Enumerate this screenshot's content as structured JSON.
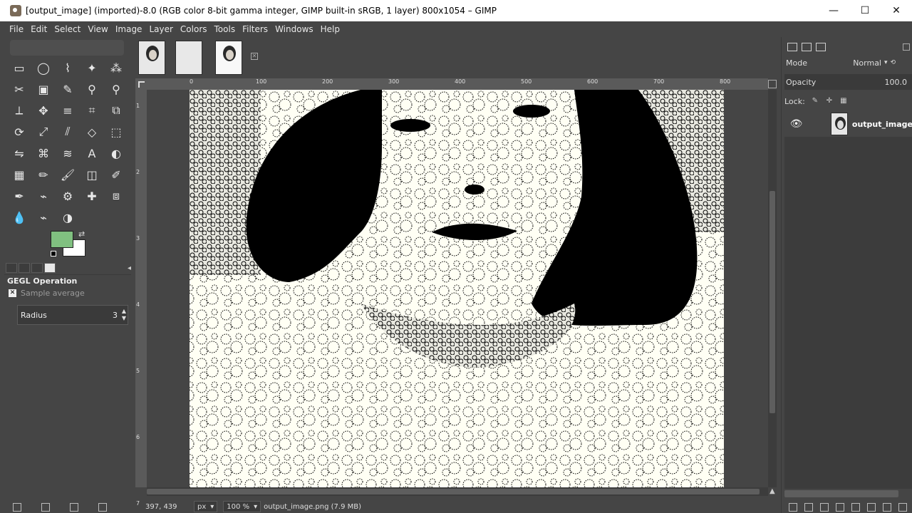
{
  "window": {
    "title": "[output_image] (imported)-8.0 (RGB color 8-bit gamma integer, GIMP built-in sRGB, 1 layer) 800x1054 – GIMP",
    "minimize": "—",
    "maximize": "☐",
    "close": "✕"
  },
  "menus": [
    "File",
    "Edit",
    "Select",
    "View",
    "Image",
    "Layer",
    "Colors",
    "Tools",
    "Filters",
    "Windows",
    "Help"
  ],
  "tools": [
    "rect-select-icon",
    "ellipse-select-icon",
    "free-select-icon",
    "fuzzy-select-icon",
    "select-by-color-icon",
    "scissors-select-icon",
    "foreground-select-icon",
    "paths-icon",
    "color-picker-icon",
    "zoom-icon",
    "measure-icon",
    "move-icon",
    "align-icon",
    "crop-icon",
    "unified-transform-icon",
    "rotate-icon",
    "scale-icon",
    "shear-icon",
    "perspective-icon",
    "3d-transform-icon",
    "flip-icon",
    "cage-transform-icon",
    "warp-transform-icon",
    "text-icon",
    "bucket-fill-icon",
    "gradient-icon",
    "pencil-icon",
    "paintbrush-icon",
    "eraser-icon",
    "airbrush-icon",
    "ink-icon",
    "mypaint-brush-icon",
    "clone-icon",
    "heal-icon",
    "perspective-clone-icon",
    "blur-icon",
    "smudge-icon",
    "dodge-burn-icon"
  ],
  "colors": {
    "foreground": "#80c080",
    "background": "#ffffff"
  },
  "tool_options": {
    "title": "GEGL Operation",
    "sample_average": "Sample average",
    "radius_label": "Radius",
    "radius_value": "3"
  },
  "image_tabs": [
    "output_image thumbnail",
    "blank thumbnail",
    "portrait thumbnail"
  ],
  "ruler": {
    "top_labels": [
      "0",
      "100",
      "200",
      "300",
      "400",
      "500",
      "600",
      "700",
      "800"
    ],
    "left_labels": [
      "1",
      "2",
      "3",
      "4",
      "5",
      "6",
      "7"
    ]
  },
  "status": {
    "coords": "397, 439",
    "unit": "px",
    "zoom": "100 %",
    "file_info": "output_image.png (7.9 MB)"
  },
  "layers_panel": {
    "mode_label": "Mode",
    "mode_value": "Normal",
    "opacity_label": "Opacity",
    "opacity_value": "100.0",
    "lock_label": "Lock:",
    "layers": [
      {
        "name": "output_image"
      }
    ]
  }
}
